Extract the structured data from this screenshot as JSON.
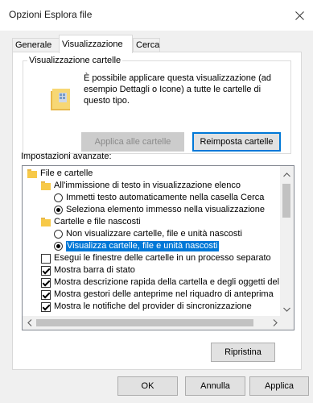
{
  "window": {
    "title": "Opzioni Esplora file"
  },
  "tabs": [
    {
      "label": "Generale"
    },
    {
      "label": "Visualizzazione",
      "active": true
    },
    {
      "label": "Cerca"
    }
  ],
  "folder_view": {
    "legend": "Visualizzazione cartelle",
    "description": "È possibile applicare questa visualizzazione (ad esempio Dettagli o Icone) a tutte le cartelle di questo tipo.",
    "apply_button": "Applica alle cartelle",
    "reset_button": "Reimposta cartelle"
  },
  "advanced": {
    "label": "Impostazioni avanzate:",
    "items": [
      {
        "type": "folder",
        "label": "File e cartelle"
      },
      {
        "type": "folder",
        "label": "All'immissione di testo in visualizzazione elenco"
      },
      {
        "type": "radio",
        "checked": false,
        "label": "Immetti testo automaticamente nella casella Cerca"
      },
      {
        "type": "radio",
        "checked": true,
        "label": "Seleziona elemento immesso nella visualizzazione"
      },
      {
        "type": "folder",
        "label": "Cartelle e file nascosti"
      },
      {
        "type": "radio",
        "checked": false,
        "label": "Non visualizzare cartelle, file e unità nascosti"
      },
      {
        "type": "radio",
        "checked": true,
        "selected": true,
        "label": "Visualizza cartelle, file e unità nascosti"
      },
      {
        "type": "check",
        "checked": false,
        "label": "Esegui le finestre delle cartelle in un processo separato"
      },
      {
        "type": "check",
        "checked": true,
        "label": "Mostra barra di stato"
      },
      {
        "type": "check",
        "checked": true,
        "label": "Mostra descrizione rapida della cartella e degli oggetti del d"
      },
      {
        "type": "check",
        "checked": true,
        "label": "Mostra gestori delle anteprime nel riquadro di anteprima"
      },
      {
        "type": "check",
        "checked": true,
        "label": "Mostra le notifiche del provider di sincronizzazione"
      }
    ],
    "restore_button": "Ripristina"
  },
  "footer": {
    "ok": "OK",
    "cancel": "Annulla",
    "apply": "Applica"
  }
}
